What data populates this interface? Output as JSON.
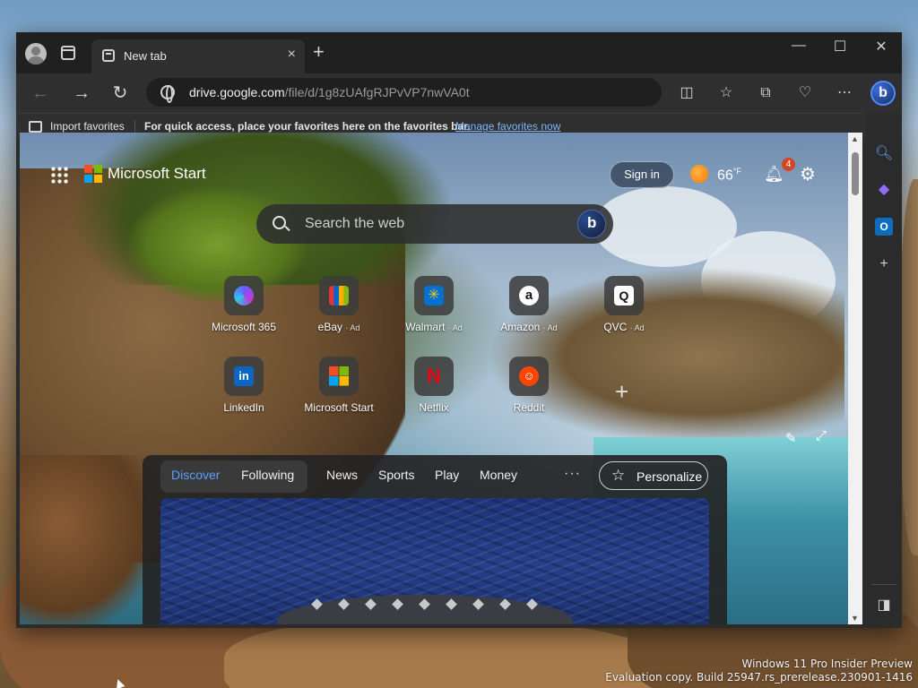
{
  "browser": {
    "tab_title": "New tab",
    "tab_close": "×",
    "new_tab": "+",
    "window_controls": {
      "minimize": "—",
      "maximize": "☐",
      "close": "✕"
    },
    "nav": {
      "back": "←",
      "forward": "→",
      "refresh": "↻"
    },
    "address": {
      "host": "drive.google.com",
      "path": "/file/d/1g8zUAfgRJPvVP7nwVA0t"
    },
    "toolbar_icons": [
      "split-screen-icon",
      "favorites-icon",
      "collections-icon",
      "browser-essentials-icon",
      "more-icon",
      "copilot-icon"
    ],
    "favorites_bar": {
      "import_label": "Import favorites",
      "hint": "For quick access, place your favorites here on the favorites bar.",
      "manage_link": "Manage favorites now"
    }
  },
  "start_page": {
    "brand": "Microsoft Start",
    "sign_in": "Sign in",
    "weather": {
      "temp": "66",
      "unit": "°F"
    },
    "notification_count": "4",
    "search_placeholder": "Search the web",
    "tiles": [
      {
        "label": "Microsoft 365",
        "ad": ""
      },
      {
        "label": "eBay",
        "ad": "· Ad"
      },
      {
        "label": "Walmart",
        "ad": "· Ad"
      },
      {
        "label": "Amazon",
        "ad": "· Ad"
      },
      {
        "label": "QVC",
        "ad": "· Ad"
      },
      {
        "label": "LinkedIn",
        "ad": ""
      },
      {
        "label": "Microsoft Start",
        "ad": ""
      },
      {
        "label": "Netflix",
        "ad": ""
      },
      {
        "label": "Reddit",
        "ad": ""
      }
    ],
    "add_tile": "+",
    "feed": {
      "tabs": [
        "Discover",
        "Following",
        "News",
        "Sports",
        "Play",
        "Money"
      ],
      "more": "···",
      "personalize": "Personalize"
    }
  },
  "desktop": {
    "watermark_line1": "Windows 11 Pro Insider Preview",
    "watermark_line2": "Evaluation copy. Build 25947.rs_prerelease.230901-1416"
  },
  "colors": {
    "accent_blue": "#5aa0ff",
    "link_blue": "#7cb7ff",
    "badge_red": "#d24726"
  }
}
